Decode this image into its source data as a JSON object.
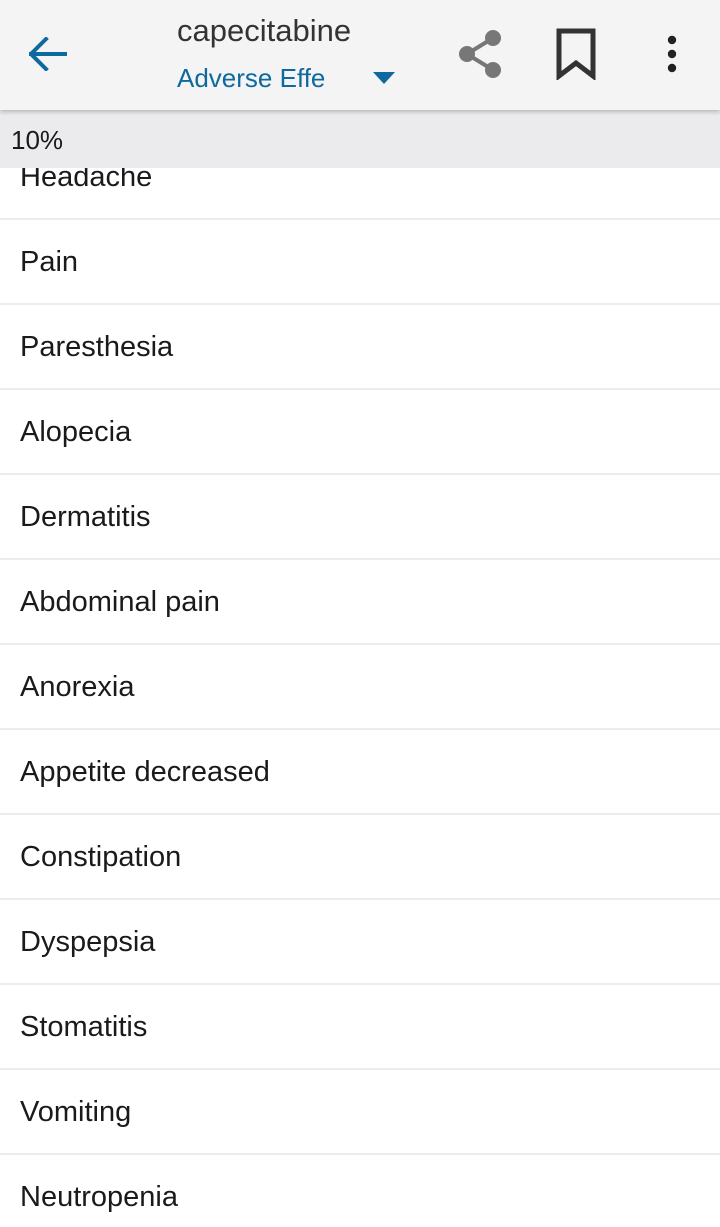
{
  "appbar": {
    "title": "capecitabine",
    "section": "Adverse Effe",
    "icons": {
      "back": "arrow-left",
      "share": "share",
      "bookmark": "bookmark",
      "more": "more-vertical"
    },
    "colors": {
      "accent": "#0e6a9e",
      "icon_gray": "#777777",
      "icon_dark": "#333333"
    }
  },
  "group": {
    "label": "10%"
  },
  "items": [
    {
      "label": "Headache"
    },
    {
      "label": "Pain"
    },
    {
      "label": "Paresthesia"
    },
    {
      "label": "Alopecia"
    },
    {
      "label": "Dermatitis"
    },
    {
      "label": "Abdominal pain"
    },
    {
      "label": "Anorexia"
    },
    {
      "label": "Appetite decreased"
    },
    {
      "label": "Constipation"
    },
    {
      "label": "Dyspepsia"
    },
    {
      "label": "Stomatitis"
    },
    {
      "label": "Vomiting"
    },
    {
      "label": "Neutropenia"
    }
  ]
}
